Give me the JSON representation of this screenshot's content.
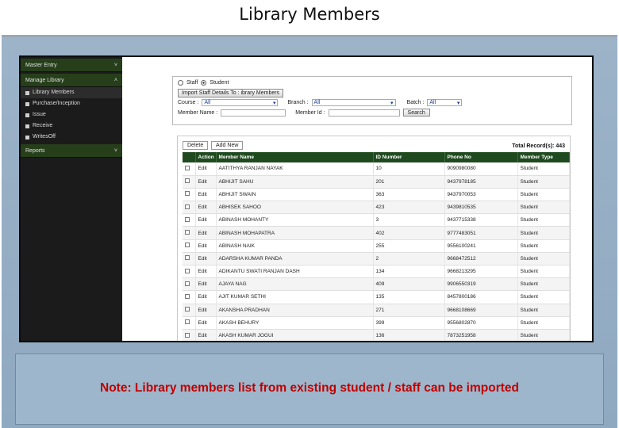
{
  "slide": {
    "title": "Library Members",
    "note": "Note: Library members list from existing student / staff can be imported"
  },
  "sidebar": {
    "sections": [
      {
        "label": "Master Entry",
        "chevron": "˅"
      },
      {
        "label": "Manage Library",
        "chevron": "˄"
      },
      {
        "label": "Reports",
        "chevron": "˅"
      }
    ],
    "items": [
      {
        "label": "Library Members",
        "icon": "list-icon"
      },
      {
        "label": "Purchase/Inception",
        "icon": "list-icon"
      },
      {
        "label": "Issue",
        "icon": "list-icon"
      },
      {
        "label": "Receive",
        "icon": "list-icon"
      },
      {
        "label": "WritesOff",
        "icon": "list-icon"
      }
    ]
  },
  "filters": {
    "radio_staff": "Staff",
    "radio_student": "Student",
    "selected_radio": "Student",
    "import_button": "Import Staff Details To : ibrary Members",
    "course_label": "Course :",
    "course_value": "All",
    "branch_label": "Branch :",
    "branch_value": "All",
    "batch_label": "Batch :",
    "batch_value": "All",
    "member_name_label": "Member Name :",
    "member_name_value": "",
    "member_id_label": "Member Id :",
    "member_id_value": "",
    "search_button": "Search"
  },
  "table": {
    "delete_tab": "Delete",
    "add_new_tab": "Add New",
    "total_records": "Total Record(s): 443",
    "columns": [
      "",
      "Action",
      "Member Name",
      "ID Number",
      "Phone No",
      "Member Type"
    ],
    "rows": [
      [
        "Edit",
        "AATITHYA RANJAN NAYAK",
        "10",
        "9090980080",
        "Student"
      ],
      [
        "Edit",
        "ABHIJIT SAHU",
        "201",
        "9437978185",
        "Student"
      ],
      [
        "Edit",
        "ABHIJIT SWAIN",
        "363",
        "9437970053",
        "Student"
      ],
      [
        "Edit",
        "ABHISEK SAHOO",
        "423",
        "9439810535",
        "Student"
      ],
      [
        "Edit",
        "ABINASH MOHANTY",
        "3",
        "9437715338",
        "Student"
      ],
      [
        "Edit",
        "ABINASH MOHAPATRA",
        "402",
        "9777483051",
        "Student"
      ],
      [
        "Edit",
        "ABINASH NAIK",
        "255",
        "9556100241",
        "Student"
      ],
      [
        "Edit",
        "ADARSHA KUMAR PANDA",
        "2",
        "9668472512",
        "Student"
      ],
      [
        "Edit",
        "ADIKANTU SWATI RANJAN DASH",
        "134",
        "9668213295",
        "Student"
      ],
      [
        "Edit",
        "AJAYA NAG",
        "409",
        "9906550319",
        "Student"
      ],
      [
        "Edit",
        "AJIT KUMAR SETHI",
        "135",
        "8457800186",
        "Student"
      ],
      [
        "Edit",
        "AKANSHA PRADHAN",
        "271",
        "9668108669",
        "Student"
      ],
      [
        "Edit",
        "AKASH BEHURY",
        "399",
        "9556802870",
        "Student"
      ],
      [
        "Edit",
        "AKASH KUMAR JOGUI",
        "136",
        "7873251958",
        "Student"
      ]
    ]
  }
}
